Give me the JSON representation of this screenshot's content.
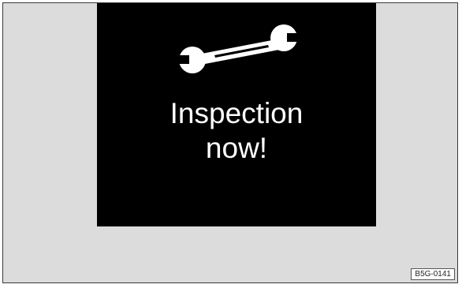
{
  "display": {
    "icon": "wrench-icon",
    "message_line1": "Inspection",
    "message_line2": "now!",
    "background_color": "#000000",
    "text_color": "#ffffff"
  },
  "figure": {
    "reference_code": "B5G-0141",
    "background_color": "#dcdcdc"
  }
}
